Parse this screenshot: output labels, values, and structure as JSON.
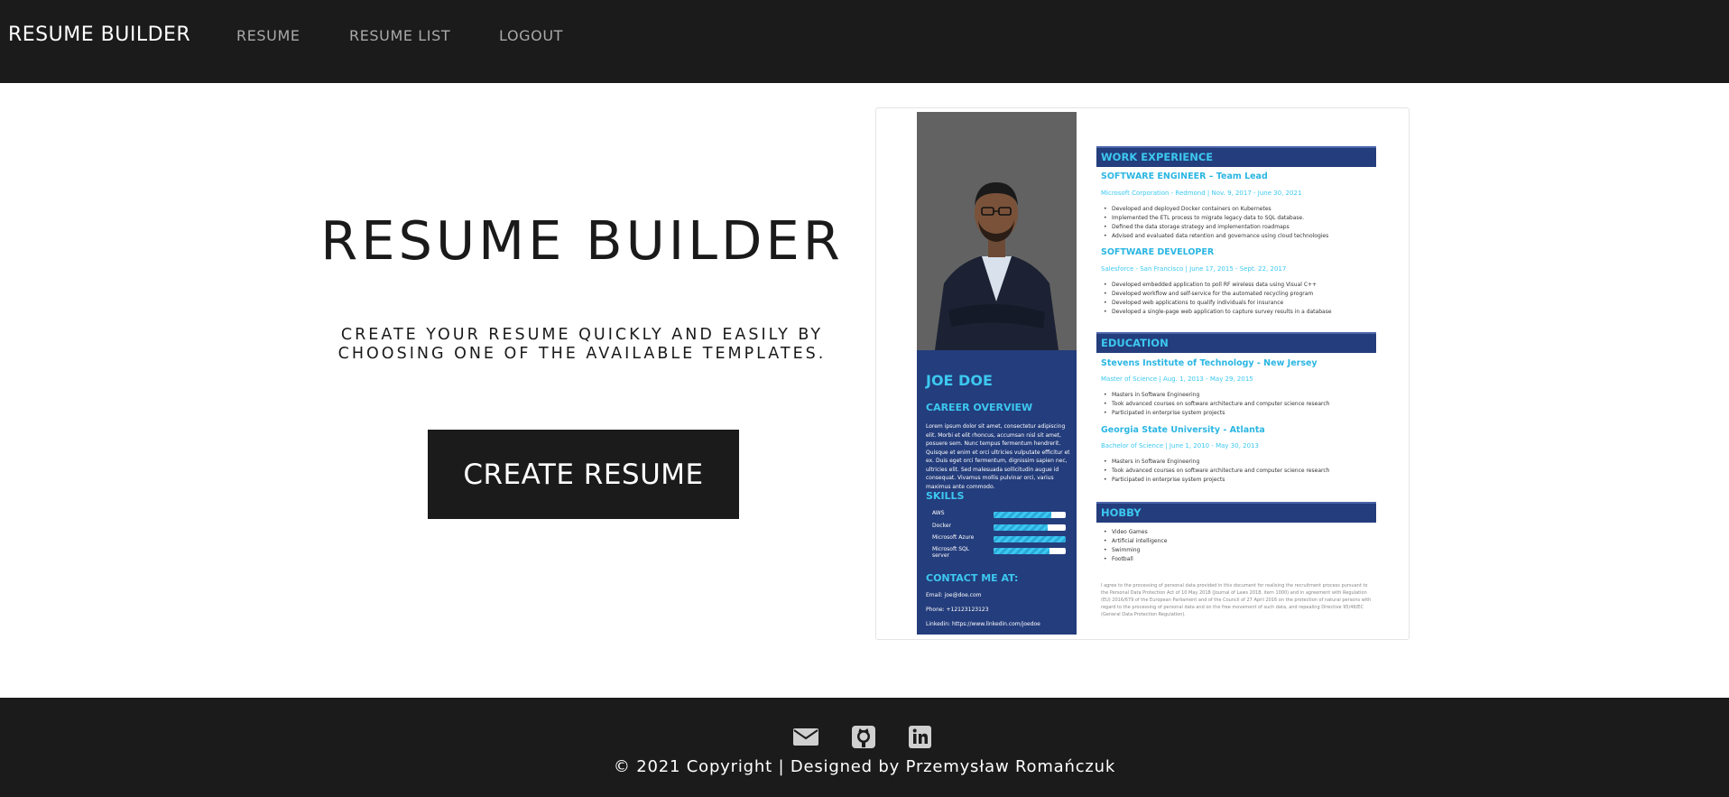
{
  "navbar": {
    "brand": "RESUME BUILDER",
    "links": [
      "RESUME",
      "RESUME LIST",
      "LOGOUT"
    ]
  },
  "hero": {
    "title": "RESUME BUILDER",
    "subtitle_line1": "CREATE YOUR RESUME QUICKLY AND EASILY BY",
    "subtitle_line2": "CHOOSING ONE OF THE AVAILABLE TEMPLATES.",
    "button_label": "CREATE RESUME"
  },
  "preview": {
    "name": "JOE DOE",
    "career_overview_heading": "CAREER OVERVIEW",
    "career_overview_text": "Lorem ipsum dolor sit amet, consectetur adipiscing elit. Morbi et elit rhoncus, accumsan nisl sit amet, posuere sem. Nunc tempus fermentum hendrerit. Quisque et enim et orci ultricies vulputate efficitur et ex. Duis eget orci fermentum, dignissim sapien nec, ultricies elit. Sed malesuada sollicitudin augue id consequat. Vivamus mollis pulvinar orci, varius maximus ante commodo.",
    "skills_heading": "SKILLS",
    "skills": [
      {
        "name": "AWS",
        "level": 0.8
      },
      {
        "name": "Docker",
        "level": 0.75
      },
      {
        "name": "Microsoft Azure",
        "level": 1.0
      },
      {
        "name": "Microsoft SQL server",
        "level": 0.78
      }
    ],
    "contact_heading": "CONTACT ME AT:",
    "contact": [
      "Email: joe@doe.com",
      "Phone: +12123123123",
      "Linkedin: https://www.linkedin.com/joedoe"
    ],
    "work_heading": "WORK EXPERIENCE",
    "jobs": [
      {
        "title": "SOFTWARE ENGINEER – Team Lead",
        "meta": "Microsoft Corporation - Redmond | Nov. 9, 2017 - June 30, 2021",
        "bullets": [
          "Developed and deployed Docker containers on Kubernetes",
          "Implemented the ETL process to migrate legacy data to SQL database.",
          "Defined the data storage strategy and implementation roadmaps",
          "Advised and evaluated data retention and governance using cloud technologies"
        ]
      },
      {
        "title": "SOFTWARE DEVELOPER",
        "meta": "Salesforce - San Francisco | June 17, 2015 - Sept. 22, 2017",
        "bullets": [
          "Developed embedded application to poll RF wireless data using Visual C++",
          "Developed workflow and self-service for the automated recycling program",
          "Developed web applications to qualify individuals for insurance",
          "Developed a single-page web application to capture survey results in a database"
        ]
      }
    ],
    "education_heading": "EDUCATION",
    "schools": [
      {
        "title": "Stevens Institute of Technology - New Jersey",
        "meta": "Master of Science | Aug. 1, 2013 - May 29, 2015",
        "bullets": [
          "Masters in Software Engineering",
          "Took advanced courses on software architecture and computer science research",
          "Participated in enterprise system projects"
        ]
      },
      {
        "title": "Georgia State University - Atlanta",
        "meta": "Bachelor of Science | June 1, 2010 - May 30, 2013",
        "bullets": [
          "Masters in Software Engineering",
          "Took advanced courses on software architecture and computer science research",
          "Participated in enterprise system projects"
        ]
      }
    ],
    "hobby_heading": "HOBBY",
    "hobbies": [
      "Video Games",
      "Artificial intelligence",
      "Swimming",
      "Football"
    ],
    "gdpr": "I agree to the processing of personal data provided in this document for realising the recruitment process pursuant to the Personal Data Protection Act of 10 May 2018 (Journal of Laws 2018, item 1000) and in agreement with Regulation (EU) 2016/679 of the European Parliament and of the Council of 27 April 2016 on the protection of natural persons with regard to the processing of personal data and on the free movement of such data, and repealing Directive 95/46/EC (General Data Protection Regulation)."
  },
  "footer": {
    "icons": [
      "mail-icon",
      "github-icon",
      "linkedin-icon"
    ],
    "copyright": "© 2021 Copyright | Designed by Przemysław Romańczuk"
  },
  "colors": {
    "nav_bg": "#1b1b1b",
    "resume_navy": "#243d7c",
    "resume_cyan": "#3cc8f0"
  }
}
